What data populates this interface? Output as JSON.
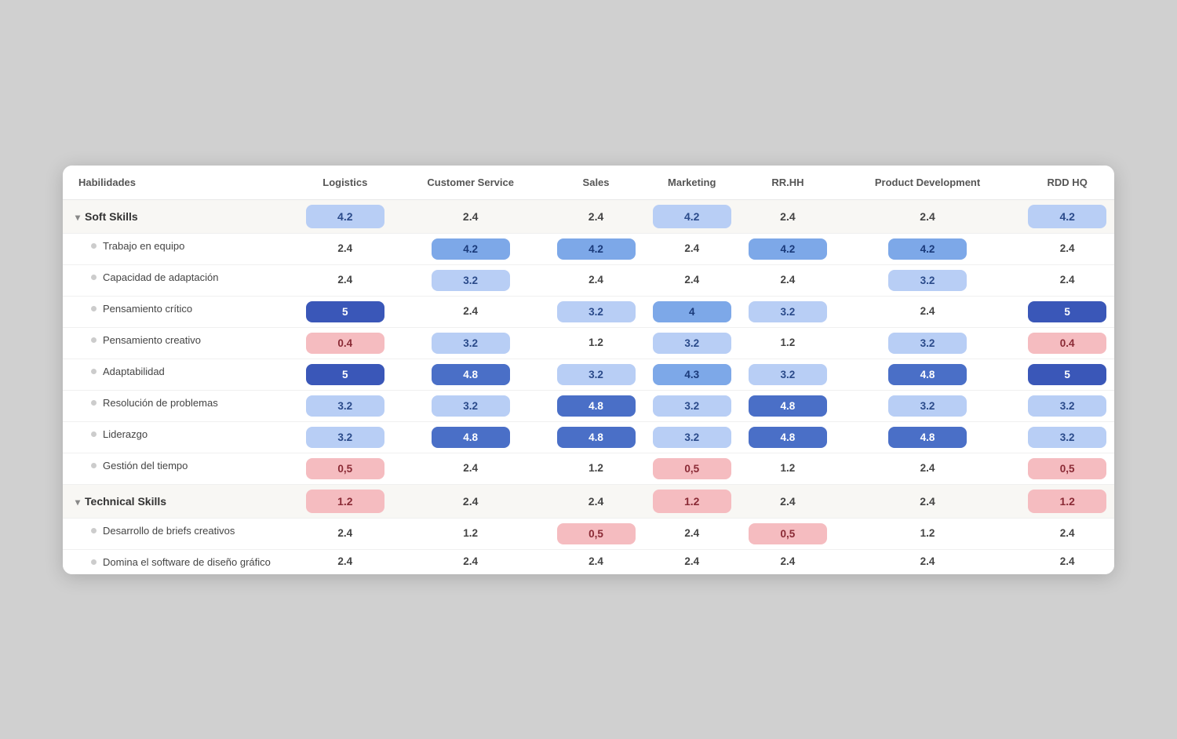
{
  "header": {
    "col0": "Habilidades",
    "col1": "Logistics",
    "col2": "Customer Service",
    "col3": "Sales",
    "col4": "Marketing",
    "col5": "RR.HH",
    "col6": "Product Development",
    "col7": "RDD HQ"
  },
  "groups": [
    {
      "label": "Soft Skills",
      "group_values": [
        "4.2",
        "2.4",
        "2.4",
        "4.2",
        "2.4",
        "2.4",
        "4.2"
      ],
      "group_colors": [
        "c-blue-light",
        "c-plain",
        "c-plain",
        "c-blue-light",
        "c-plain",
        "c-plain",
        "c-blue-light"
      ],
      "rows": [
        {
          "label": "Trabajo en equipo",
          "values": [
            "2.4",
            "4.2",
            "4.2",
            "2.4",
            "4.2",
            "4.2",
            "2.4"
          ],
          "colors": [
            "c-plain",
            "c-blue-med",
            "c-blue-med",
            "c-plain",
            "c-blue-med",
            "c-blue-med",
            "c-plain"
          ]
        },
        {
          "label": "Capacidad de adaptación",
          "values": [
            "2.4",
            "3.2",
            "2.4",
            "2.4",
            "2.4",
            "3.2",
            "2.4"
          ],
          "colors": [
            "c-plain",
            "c-blue-light",
            "c-plain",
            "c-plain",
            "c-plain",
            "c-blue-light",
            "c-plain"
          ]
        },
        {
          "label": "Pensamiento crítico",
          "values": [
            "5",
            "2.4",
            "3.2",
            "4",
            "3.2",
            "2.4",
            "5"
          ],
          "colors": [
            "c-blue-deeper",
            "c-plain",
            "c-blue-light",
            "c-blue-med",
            "c-blue-light",
            "c-plain",
            "c-blue-deeper"
          ]
        },
        {
          "label": "Pensamiento creativo",
          "values": [
            "0.4",
            "3.2",
            "1.2",
            "3.2",
            "1.2",
            "3.2",
            "0.4"
          ],
          "colors": [
            "c-pink-light",
            "c-blue-light",
            "c-plain",
            "c-blue-light",
            "c-plain",
            "c-blue-light",
            "c-pink-light"
          ]
        },
        {
          "label": "Adaptabilidad",
          "values": [
            "5",
            "4.8",
            "3.2",
            "4.3",
            "3.2",
            "4.8",
            "5"
          ],
          "colors": [
            "c-blue-deeper",
            "c-blue-dark",
            "c-blue-light",
            "c-blue-med",
            "c-blue-light",
            "c-blue-dark",
            "c-blue-deeper"
          ]
        },
        {
          "label": "Resolución de problemas",
          "values": [
            "3.2",
            "3.2",
            "4.8",
            "3.2",
            "4.8",
            "3.2",
            "3.2"
          ],
          "colors": [
            "c-blue-light",
            "c-blue-light",
            "c-blue-dark",
            "c-blue-light",
            "c-blue-dark",
            "c-blue-light",
            "c-blue-light"
          ]
        },
        {
          "label": "Liderazgo",
          "values": [
            "3.2",
            "4.8",
            "4.8",
            "3.2",
            "4.8",
            "4.8",
            "3.2"
          ],
          "colors": [
            "c-blue-light",
            "c-blue-dark",
            "c-blue-dark",
            "c-blue-light",
            "c-blue-dark",
            "c-blue-dark",
            "c-blue-light"
          ]
        },
        {
          "label": "Gestión del tiempo",
          "values": [
            "0,5",
            "2.4",
            "1.2",
            "0,5",
            "1.2",
            "2.4",
            "0,5"
          ],
          "colors": [
            "c-pink-light",
            "c-plain",
            "c-plain",
            "c-pink-light",
            "c-plain",
            "c-plain",
            "c-pink-light"
          ]
        }
      ]
    },
    {
      "label": "Technical Skills",
      "group_values": [
        "1.2",
        "2.4",
        "2.4",
        "1.2",
        "2.4",
        "2.4",
        "1.2"
      ],
      "group_colors": [
        "c-pink-light",
        "c-plain",
        "c-plain",
        "c-pink-light",
        "c-plain",
        "c-plain",
        "c-pink-light"
      ],
      "rows": [
        {
          "label": "Desarrollo de briefs creativos",
          "values": [
            "2.4",
            "1.2",
            "0,5",
            "2.4",
            "0,5",
            "1.2",
            "2.4"
          ],
          "colors": [
            "c-plain",
            "c-plain",
            "c-pink-light",
            "c-plain",
            "c-pink-light",
            "c-plain",
            "c-plain"
          ]
        },
        {
          "label": "Domina el software de diseño gráfico",
          "values": [
            "2.4",
            "2.4",
            "2.4",
            "2.4",
            "2.4",
            "2.4",
            "2.4"
          ],
          "colors": [
            "c-plain",
            "c-plain",
            "c-plain",
            "c-plain",
            "c-plain",
            "c-plain",
            "c-plain"
          ]
        }
      ]
    }
  ]
}
